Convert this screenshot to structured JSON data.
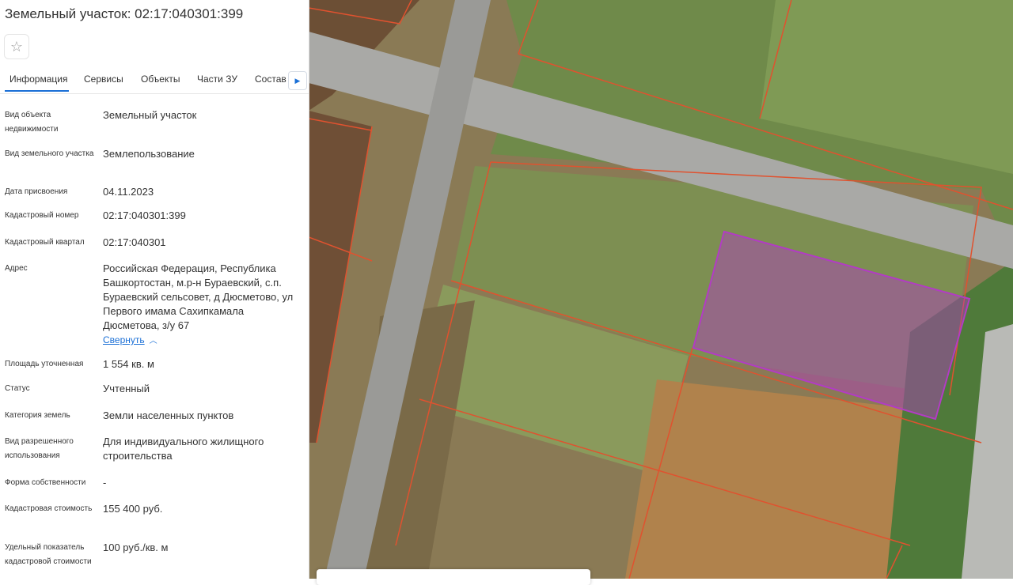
{
  "title": "Земельный участок: 02:17:040301:399",
  "tabs": [
    "Информация",
    "Сервисы",
    "Объекты",
    "Части ЗУ",
    "Состав"
  ],
  "details": [
    {
      "label": "Вид объекта недвижимости",
      "value": "Земельный участок"
    },
    {
      "label": "Вид земельного участка",
      "value": "Землепользование"
    },
    {
      "label": "Дата присвоения",
      "value": "04.11.2023"
    },
    {
      "label": "Кадастровый номер",
      "value": "02:17:040301:399"
    },
    {
      "label": "Кадастровый квартал",
      "value": "02:17:040301"
    },
    {
      "label": "Адрес",
      "value": "Российская Федерация, Республика Башкортостан, м.р-н Бураевский, с.п. Бураевский сельсовет, д Дюсметово, ул Первого имама Сахипкамала Дюсметова, з/у 67"
    },
    {
      "label": "Площадь уточненная",
      "value": "1 554 кв. м"
    },
    {
      "label": "Статус",
      "value": "Учтенный"
    },
    {
      "label": "Категория земель",
      "value": "Земли населенных пунктов"
    },
    {
      "label": "Вид разрешенного использования",
      "value": "Для индивидуального жилищного строительства"
    },
    {
      "label": "Форма собственности",
      "value": "-"
    },
    {
      "label": "Кадастровая стоимость",
      "value": "155 400 руб."
    },
    {
      "label": "Удельный показатель кадастровой стоимости",
      "value": "100 руб./кв. м"
    }
  ],
  "collapse_label": "Свернуть",
  "icons": {
    "favorite": "star-outline-icon",
    "tabs_next": "chevron-right-icon",
    "collapse": "chevron-up-icon"
  },
  "colors": {
    "accent": "#1a6fd6",
    "parcel_highlight": "#b23cc4",
    "cadastral_lines": "#e0522f"
  }
}
